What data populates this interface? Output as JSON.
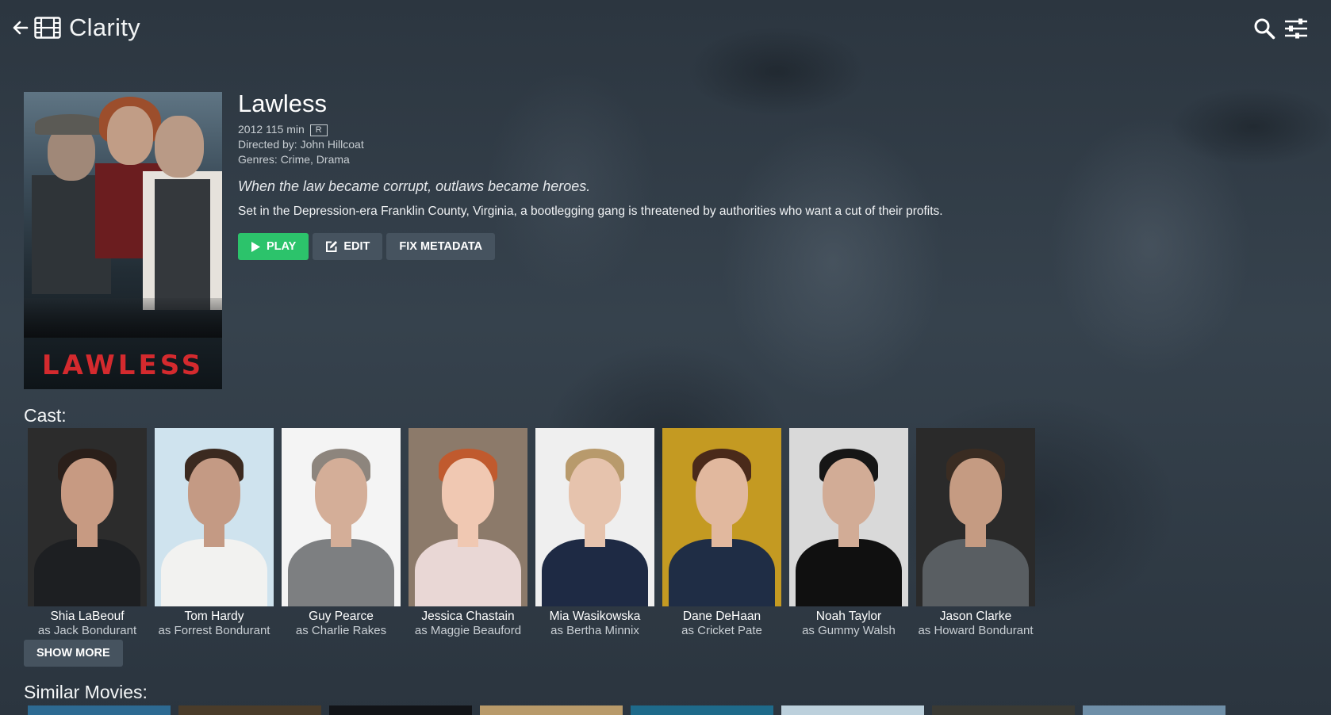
{
  "app": {
    "title": "Clarity",
    "icons": [
      "back-arrow-icon",
      "film-icon",
      "search-icon",
      "settings-sliders-icon"
    ]
  },
  "movie": {
    "title": "Lawless",
    "year": "2012",
    "runtime": "115 min",
    "rating": "R",
    "directed_by": "Directed by: John Hillcoat",
    "genres": "Genres: Crime, Drama",
    "tagline": "When the law became corrupt, outlaws became heroes.",
    "summary": "Set in the Depression-era Franklin County, Virginia, a bootlegging gang is threatened by authorities who want a cut of their profits.",
    "poster_title": "LAWLESS"
  },
  "actions": {
    "play_label": "PLAY",
    "edit_label": "EDIT",
    "fix_metadata_label": "FIX METADATA"
  },
  "cast_section": {
    "label": "Cast:",
    "show_more_label": "SHOW MORE",
    "members": [
      {
        "name": "Shia LaBeouf",
        "role": "as Jack Bondurant",
        "bg": "#2c2c2c",
        "skin": "#c79a82",
        "hair": "#2a1f1a",
        "top": "#1d1f22"
      },
      {
        "name": "Tom Hardy",
        "role": "as Forrest Bondurant",
        "bg": "#cfe3ee",
        "skin": "#c49a84",
        "hair": "#3b2a20",
        "top": "#f2f2f0"
      },
      {
        "name": "Guy Pearce",
        "role": "as Charlie Rakes",
        "bg": "#f4f4f4",
        "skin": "#d4ae98",
        "hair": "#8d857d",
        "top": "#7d7f81"
      },
      {
        "name": "Jessica Chastain",
        "role": "as Maggie Beauford",
        "bg": "#8c7a6a",
        "skin": "#f0c8b2",
        "hair": "#c05a2e",
        "top": "#e9d7d5"
      },
      {
        "name": "Mia Wasikowska",
        "role": "as Bertha Minnix",
        "bg": "#efefef",
        "skin": "#e6c3ad",
        "hair": "#b89a6c",
        "top": "#1e2a44"
      },
      {
        "name": "Dane DeHaan",
        "role": "as Cricket Pate",
        "bg": "#c49a22",
        "skin": "#e1b89e",
        "hair": "#4a2a1a",
        "top": "#1f2d45"
      },
      {
        "name": "Noah Taylor",
        "role": "as Gummy Walsh",
        "bg": "#d9d9d9",
        "skin": "#d2ac96",
        "hair": "#161616",
        "top": "#101010"
      },
      {
        "name": "Jason Clarke",
        "role": "as Howard Bondurant",
        "bg": "#2a2a2a",
        "skin": "#c59b82",
        "hair": "#3a2c22",
        "top": "#595e62"
      }
    ]
  },
  "similar_section": {
    "label": "Similar Movies:",
    "thumb_colors": [
      "#2d6a92",
      "#4a3c2a",
      "#121418",
      "#b89a6a",
      "#1e6a8a",
      "#bcd0dc",
      "#3a3a34",
      "#6f8fa8"
    ]
  }
}
